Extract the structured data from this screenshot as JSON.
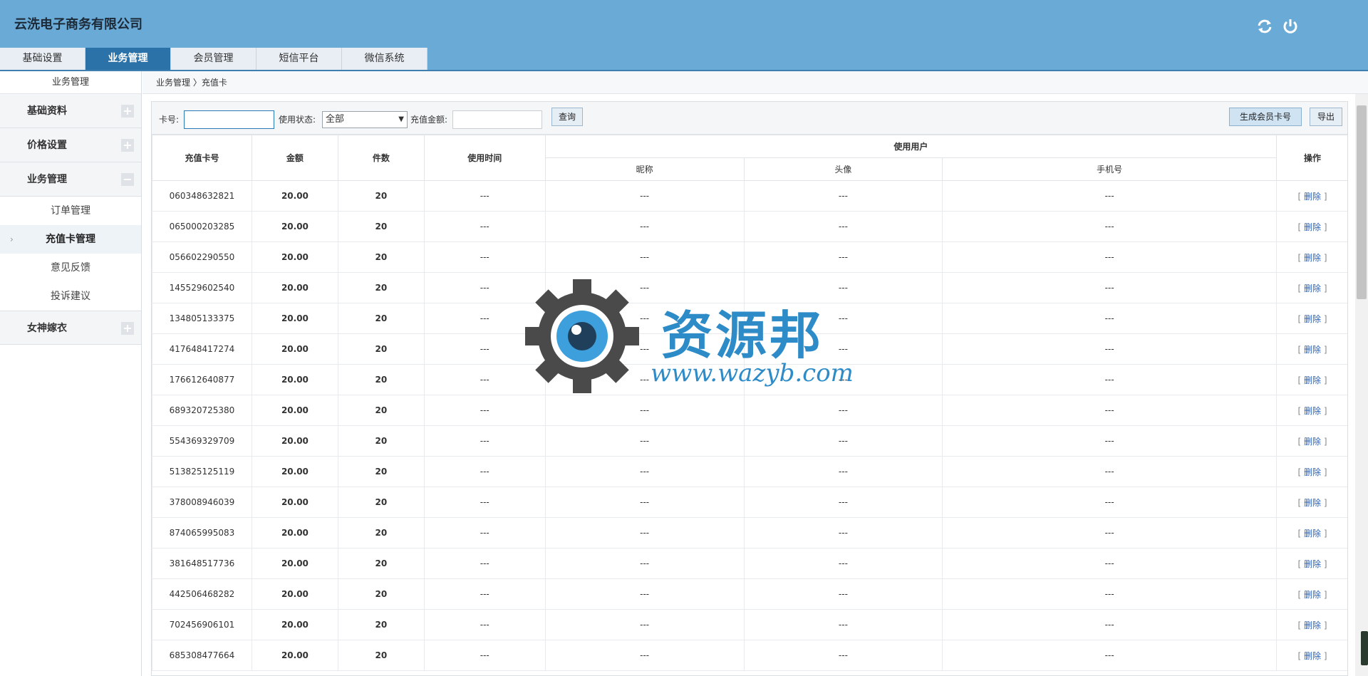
{
  "header": {
    "company": "云洗电子商务有限公司",
    "icons": [
      "refresh-icon",
      "power-icon"
    ]
  },
  "nav": {
    "tabs": [
      {
        "label": "基础设置"
      },
      {
        "label": "业务管理"
      },
      {
        "label": "会员管理"
      },
      {
        "label": "短信平台"
      },
      {
        "label": "微信系统"
      }
    ]
  },
  "sidebar": {
    "title": "业务管理",
    "groups": [
      {
        "label": "基础资料",
        "toggle": "+"
      },
      {
        "label": "价格设置",
        "toggle": "+"
      },
      {
        "label": "业务管理",
        "toggle": "−"
      },
      {
        "label": "女神嫁衣",
        "toggle": "+"
      }
    ],
    "subitems": [
      {
        "label": "订单管理"
      },
      {
        "label": "充值卡管理"
      },
      {
        "label": "意见反馈"
      },
      {
        "label": "投诉建议"
      }
    ]
  },
  "breadcrumb": "业务管理 〉充值卡",
  "toolbar": {
    "card_label": "卡号:",
    "status_label": "使用状态:",
    "status_value": "全部",
    "amount_label": "充值金额:",
    "query_label": "查询",
    "generate_label": "生成会员卡号",
    "export_label": "导出"
  },
  "table": {
    "headers": {
      "card_no": "充值卡号",
      "amount": "金额",
      "qty": "件数",
      "use_time": "使用时间",
      "user_group": "使用用户",
      "nickname": "昵称",
      "avatar": "头像",
      "phone": "手机号",
      "ops": "操作"
    },
    "delete_label": "删除",
    "rows": [
      {
        "card": "060348632821",
        "amount": "20.00",
        "qty": "20",
        "time": "---",
        "nick": "---",
        "avatar": "---",
        "phone": "---"
      },
      {
        "card": "065000203285",
        "amount": "20.00",
        "qty": "20",
        "time": "---",
        "nick": "---",
        "avatar": "---",
        "phone": "---"
      },
      {
        "card": "056602290550",
        "amount": "20.00",
        "qty": "20",
        "time": "---",
        "nick": "---",
        "avatar": "---",
        "phone": "---"
      },
      {
        "card": "145529602540",
        "amount": "20.00",
        "qty": "20",
        "time": "---",
        "nick": "---",
        "avatar": "---",
        "phone": "---"
      },
      {
        "card": "134805133375",
        "amount": "20.00",
        "qty": "20",
        "time": "---",
        "nick": "---",
        "avatar": "---",
        "phone": "---"
      },
      {
        "card": "417648417274",
        "amount": "20.00",
        "qty": "20",
        "time": "---",
        "nick": "---",
        "avatar": "---",
        "phone": "---"
      },
      {
        "card": "176612640877",
        "amount": "20.00",
        "qty": "20",
        "time": "---",
        "nick": "---",
        "avatar": "---",
        "phone": "---"
      },
      {
        "card": "689320725380",
        "amount": "20.00",
        "qty": "20",
        "time": "---",
        "nick": "---",
        "avatar": "---",
        "phone": "---"
      },
      {
        "card": "554369329709",
        "amount": "20.00",
        "qty": "20",
        "time": "---",
        "nick": "---",
        "avatar": "---",
        "phone": "---"
      },
      {
        "card": "513825125119",
        "amount": "20.00",
        "qty": "20",
        "time": "---",
        "nick": "---",
        "avatar": "---",
        "phone": "---"
      },
      {
        "card": "378008946039",
        "amount": "20.00",
        "qty": "20",
        "time": "---",
        "nick": "---",
        "avatar": "---",
        "phone": "---"
      },
      {
        "card": "874065995083",
        "amount": "20.00",
        "qty": "20",
        "time": "---",
        "nick": "---",
        "avatar": "---",
        "phone": "---"
      },
      {
        "card": "381648517736",
        "amount": "20.00",
        "qty": "20",
        "time": "---",
        "nick": "---",
        "avatar": "---",
        "phone": "---"
      },
      {
        "card": "442506468282",
        "amount": "20.00",
        "qty": "20",
        "time": "---",
        "nick": "---",
        "avatar": "---",
        "phone": "---"
      },
      {
        "card": "702456906101",
        "amount": "20.00",
        "qty": "20",
        "time": "---",
        "nick": "---",
        "avatar": "---",
        "phone": "---"
      },
      {
        "card": "685308477664",
        "amount": "20.00",
        "qty": "20",
        "time": "---",
        "nick": "---",
        "avatar": "---",
        "phone": "---"
      }
    ]
  },
  "watermark": {
    "text": "资源邦",
    "url": "www.wazyb.com"
  },
  "colors": {
    "header_bg": "#6aaad6",
    "active_tab": "#2a72a8",
    "link": "#2a62b5",
    "watermark": "#2d8bc8"
  }
}
